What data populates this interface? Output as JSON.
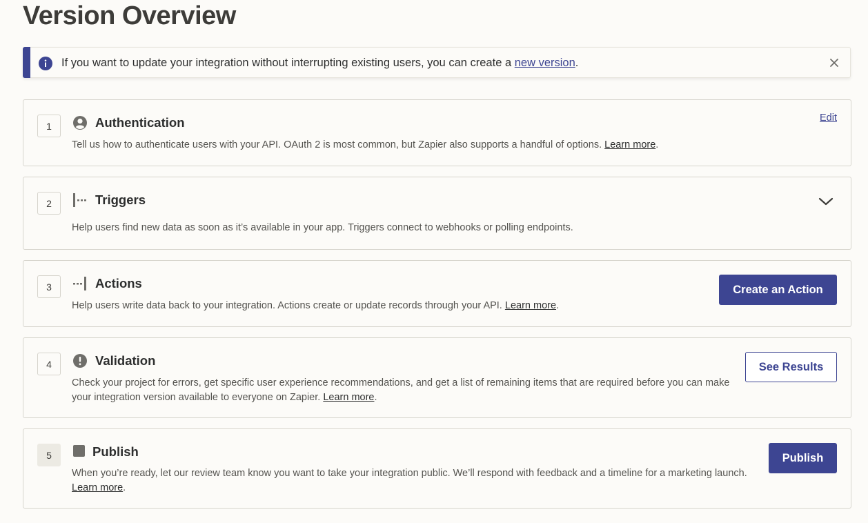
{
  "page": {
    "title": "Version Overview"
  },
  "banner": {
    "text_before": "If you want to update your integration without interrupting existing users, you can create a ",
    "link": "new version",
    "text_after": "."
  },
  "steps": [
    {
      "number": "1",
      "title": "Authentication",
      "icon": "user-circle-icon",
      "desc": "Tell us how to authenticate users with your API. OAuth 2 is most common, but Zapier also supports a handful of options. ",
      "link": "Learn more",
      "link_after": ".",
      "edit": "Edit"
    },
    {
      "number": "2",
      "title": "Triggers",
      "icon": "trigger-icon",
      "desc": "Help users find new data as soon as it’s available in your app. Triggers connect to webhooks or polling endpoints."
    },
    {
      "number": "3",
      "title": "Actions",
      "icon": "action-icon",
      "desc": "Help users write data back to your integration. Actions create or update records through your API. ",
      "link": "Learn more",
      "link_after": ".",
      "button": "Create an Action"
    },
    {
      "number": "4",
      "title": "Validation",
      "icon": "alert-circle-icon",
      "desc": "Check your project for errors, get specific user experience recommendations, and get a list of remaining items that are required before you can make your integration version available to everyone on Zapier. ",
      "link": "Learn more",
      "link_after": ".",
      "button": "See Results"
    },
    {
      "number": "5",
      "title": "Publish",
      "icon": "square-icon",
      "desc": "When you’re ready, let our review team know you want to take your integration public. We’ll respond with feedback and a timeline for a marketing launch. ",
      "link": "Learn more",
      "link_after": ".",
      "button": "Publish"
    }
  ],
  "colors": {
    "accent": "#3d4592",
    "background": "#fcfbf8",
    "border": "#d6d4cc"
  }
}
